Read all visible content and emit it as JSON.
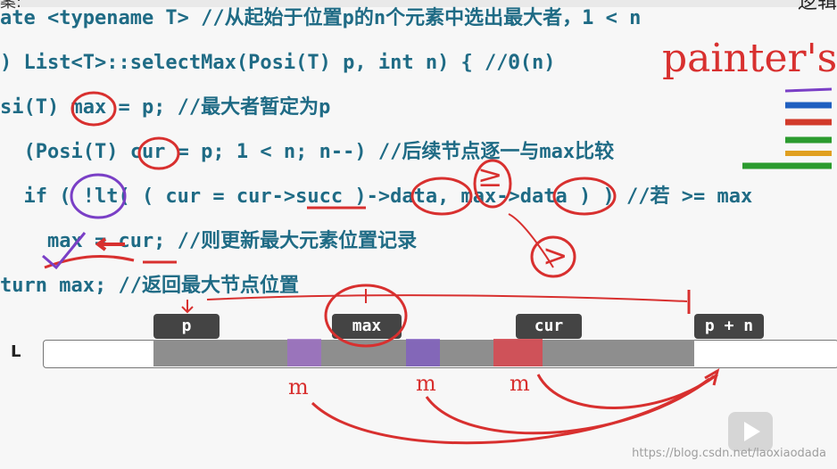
{
  "header": {
    "left_fragment": "案:",
    "right_fragment": "逻辑"
  },
  "code": {
    "line1": "ate <typename T> //从起始于位置p的n个元素中选出最大者，1 < n",
    "line2": ") List<T>::selectMax(Posi(T) p, int n) { //Θ(n)",
    "line3": "si(T) max = p; //最大者暂定为p",
    "line4": "  (Posi(T) cur = p; 1 < n; n--) //后续节点逐一与max比较",
    "line5": "  if ( !lt( ( cur = cur->succ )->data, max->data ) ) //若 >= max",
    "line6": "    max = cur; //则更新最大元素位置记录",
    "line7": "turn max; //返回最大节点位置"
  },
  "diagram": {
    "list_label": "L",
    "pointer_p": "p",
    "pointer_max": "max",
    "pointer_cur": "cur",
    "pointer_end": "p + n",
    "marks": [
      "m",
      "m",
      "m"
    ]
  },
  "annotations": {
    "painter": "painter's",
    "ge_symbol": "≥",
    "gt_symbol": ">"
  },
  "watermark": "https://blog.csdn.net/laoxiaodada",
  "colors": {
    "code_blue": "#1f6b85",
    "comment_blue": "#2c58b8",
    "annotation_red": "#d8302f",
    "annotation_purple": "#7a3fc6",
    "bar_gray": "#8e8e8e",
    "tag_dark": "#444444"
  },
  "icons": {
    "play": "play-icon"
  }
}
